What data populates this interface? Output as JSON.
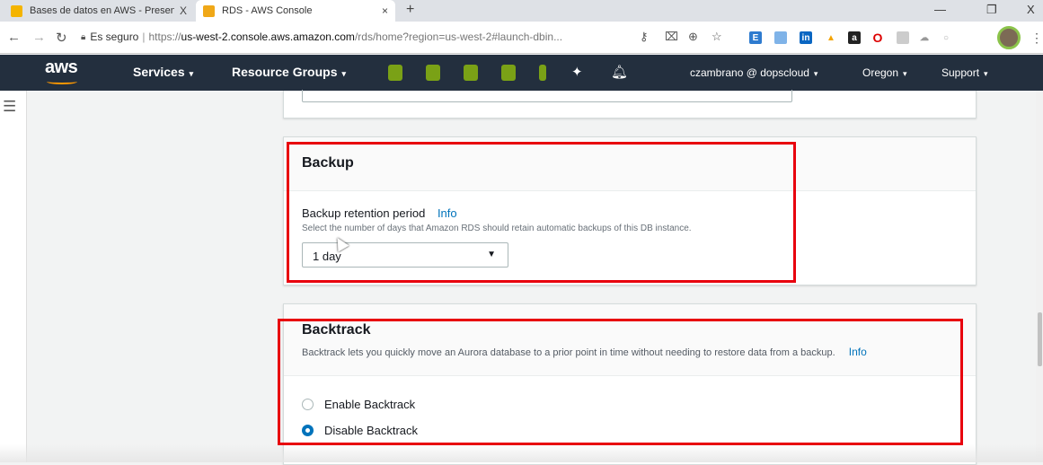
{
  "browser": {
    "tabs": [
      {
        "title": "Bases de datos en AWS - Present",
        "close": "X",
        "favicon_color": "#f4b400",
        "active": false
      },
      {
        "title": "RDS - AWS Console",
        "close": "×",
        "favicon_color": "#f0a818",
        "active": true
      }
    ],
    "new_tab": "+",
    "window_controls": {
      "minimize": "—",
      "restore": "❐",
      "close": "X"
    },
    "address": {
      "secure_label": "Es seguro",
      "separator": "|",
      "scheme": "https://",
      "host": "us-west-2.console.aws.amazon.com",
      "path": "/rds/home?region=us-west-2#launch-dbin..."
    },
    "menu": "⋮"
  },
  "aws_nav": {
    "logo": "aws",
    "services": "Services",
    "resource_groups": "Resource Groups",
    "shortcut_colors": [
      "#7aa116",
      "#7aa116",
      "#7aa116",
      "#7aa116",
      "#7aa116"
    ],
    "user": "czambrano @ dopscloud",
    "region": "Oregon",
    "support": "Support"
  },
  "backup": {
    "title": "Backup",
    "retention_label": "Backup retention period",
    "info": "Info",
    "hint": "Select the number of days that Amazon RDS should retain automatic backups of this DB instance.",
    "selected_value": "1 day"
  },
  "backtrack": {
    "title": "Backtrack",
    "description": "Backtrack lets you quickly move an Aurora database to a prior point in time without needing to restore data from a backup.",
    "info": "Info",
    "options": [
      {
        "label": "Enable Backtrack",
        "checked": false
      },
      {
        "label": "Disable Backtrack",
        "checked": true
      }
    ]
  },
  "colors": {
    "highlight": "#e8000d",
    "link": "#0073bb",
    "nav_bg": "#232f3e",
    "aws_orange": "#ff9900"
  }
}
